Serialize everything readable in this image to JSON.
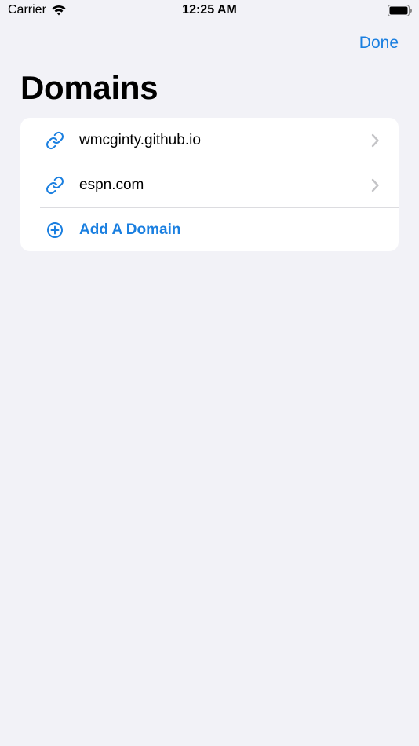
{
  "status_bar": {
    "carrier": "Carrier",
    "time": "12:25 AM",
    "wifi_icon": "wifi-icon",
    "battery_icon": "battery-icon"
  },
  "nav": {
    "done_label": "Done"
  },
  "title": "Domains",
  "domains": [
    {
      "label": "wmcginty.github.io",
      "icon": "link-icon"
    },
    {
      "label": "espn.com",
      "icon": "link-icon"
    }
  ],
  "add_domain": {
    "label": "Add A Domain",
    "icon": "plus-circle-icon"
  },
  "colors": {
    "accent": "#1a7fe0",
    "background": "#f2f2f7",
    "card": "#ffffff",
    "separator": "#dcdce0",
    "chevron": "#c4c4c7"
  }
}
